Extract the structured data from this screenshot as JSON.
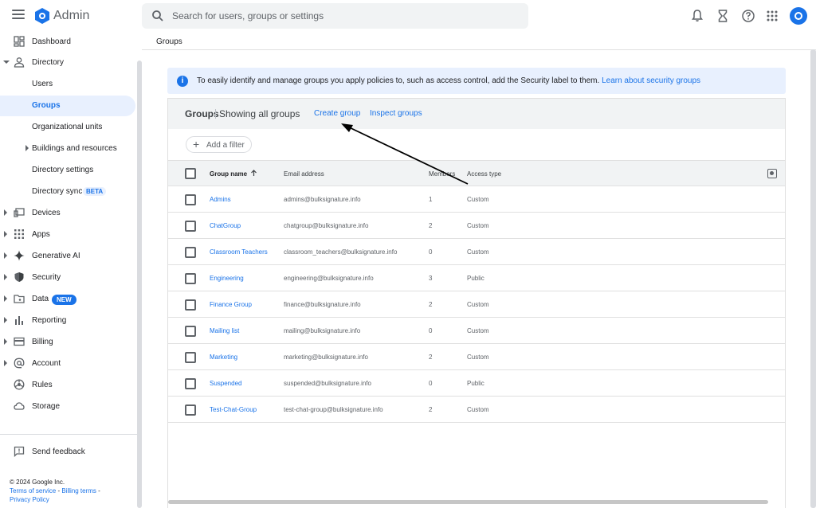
{
  "app": {
    "title": "Admin",
    "search_placeholder": "Search for users, groups or settings"
  },
  "breadcrumb": "Groups",
  "sidebar": {
    "items": [
      {
        "label": "Dashboard"
      },
      {
        "label": "Directory"
      },
      {
        "label": "Users"
      },
      {
        "label": "Groups"
      },
      {
        "label": "Organizational units"
      },
      {
        "label": "Buildings and resources"
      },
      {
        "label": "Directory settings"
      },
      {
        "label": "Directory sync",
        "badge": "BETA"
      },
      {
        "label": "Devices"
      },
      {
        "label": "Apps"
      },
      {
        "label": "Generative AI"
      },
      {
        "label": "Security"
      },
      {
        "label": "Data",
        "badge": "NEW"
      },
      {
        "label": "Reporting"
      },
      {
        "label": "Billing"
      },
      {
        "label": "Account"
      },
      {
        "label": "Rules"
      },
      {
        "label": "Storage"
      }
    ],
    "feedback": "Send feedback",
    "footer": {
      "copyright": "© 2024 Google Inc.",
      "terms": "Terms of service",
      "billing_terms": "Billing terms",
      "privacy": "Privacy Policy"
    }
  },
  "banner": {
    "text": "To easily identify and manage groups you apply policies to, such as access control, add the Security label to them.",
    "link": "Learn about security groups"
  },
  "card": {
    "title": "Groups",
    "subtitle": "Showing all groups",
    "create_link": "Create group",
    "inspect_link": "Inspect groups",
    "filter_label": "Add a filter",
    "columns": {
      "name": "Group name",
      "email": "Email address",
      "members": "Members",
      "access": "Access type"
    },
    "rows": [
      {
        "name": "Admins",
        "email": "admins@bulksignature.info",
        "members": "1",
        "access": "Custom"
      },
      {
        "name": "ChatGroup",
        "email": "chatgroup@bulksignature.info",
        "members": "2",
        "access": "Custom"
      },
      {
        "name": "Classroom Teachers",
        "email": "classroom_teachers@bulksignature.info",
        "members": "0",
        "access": "Custom"
      },
      {
        "name": "Engineering",
        "email": "engineering@bulksignature.info",
        "members": "3",
        "access": "Public"
      },
      {
        "name": "Finance Group",
        "email": "finance@bulksignature.info",
        "members": "2",
        "access": "Custom"
      },
      {
        "name": "Mailing list",
        "email": "mailing@bulksignature.info",
        "members": "0",
        "access": "Custom"
      },
      {
        "name": "Marketing",
        "email": "marketing@bulksignature.info",
        "members": "2",
        "access": "Custom"
      },
      {
        "name": "Suspended",
        "email": "suspended@bulksignature.info",
        "members": "0",
        "access": "Public"
      },
      {
        "name": "Test-Chat-Group",
        "email": "test-chat-group@bulksignature.info",
        "members": "2",
        "access": "Custom"
      }
    ]
  },
  "colors": {
    "accent": "#1a73e8",
    "banner_bg": "#e8f0fe",
    "header_bg": "#f1f3f4"
  }
}
